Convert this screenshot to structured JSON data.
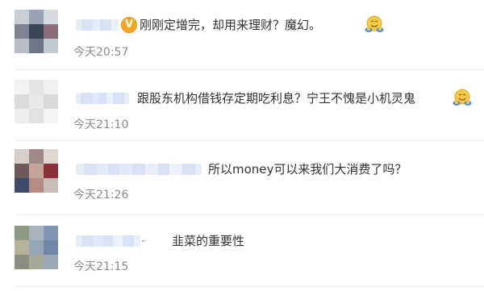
{
  "comments": [
    {
      "text": "刚刚定增完，却用来理财？魔幻。",
      "time": "今天20:57",
      "verified_icon": "verified-v-icon",
      "emoji": "hug-emoji-icon"
    },
    {
      "text": "跟股东机构借钱存定期吃利息？宁王不愧是小机灵鬼",
      "time": "今天21:10",
      "emoji": "hug-emoji-icon"
    },
    {
      "text": "所以money可以来我们大消费了吗？",
      "time": "今天21:26"
    },
    {
      "name_tail": "-",
      "text": "韭菜的重要性",
      "time": "今天21:15"
    }
  ],
  "colors": {
    "text": "#333333",
    "time": "#8c8c8c",
    "verified": "#f5a623",
    "divider": "#ececec"
  }
}
